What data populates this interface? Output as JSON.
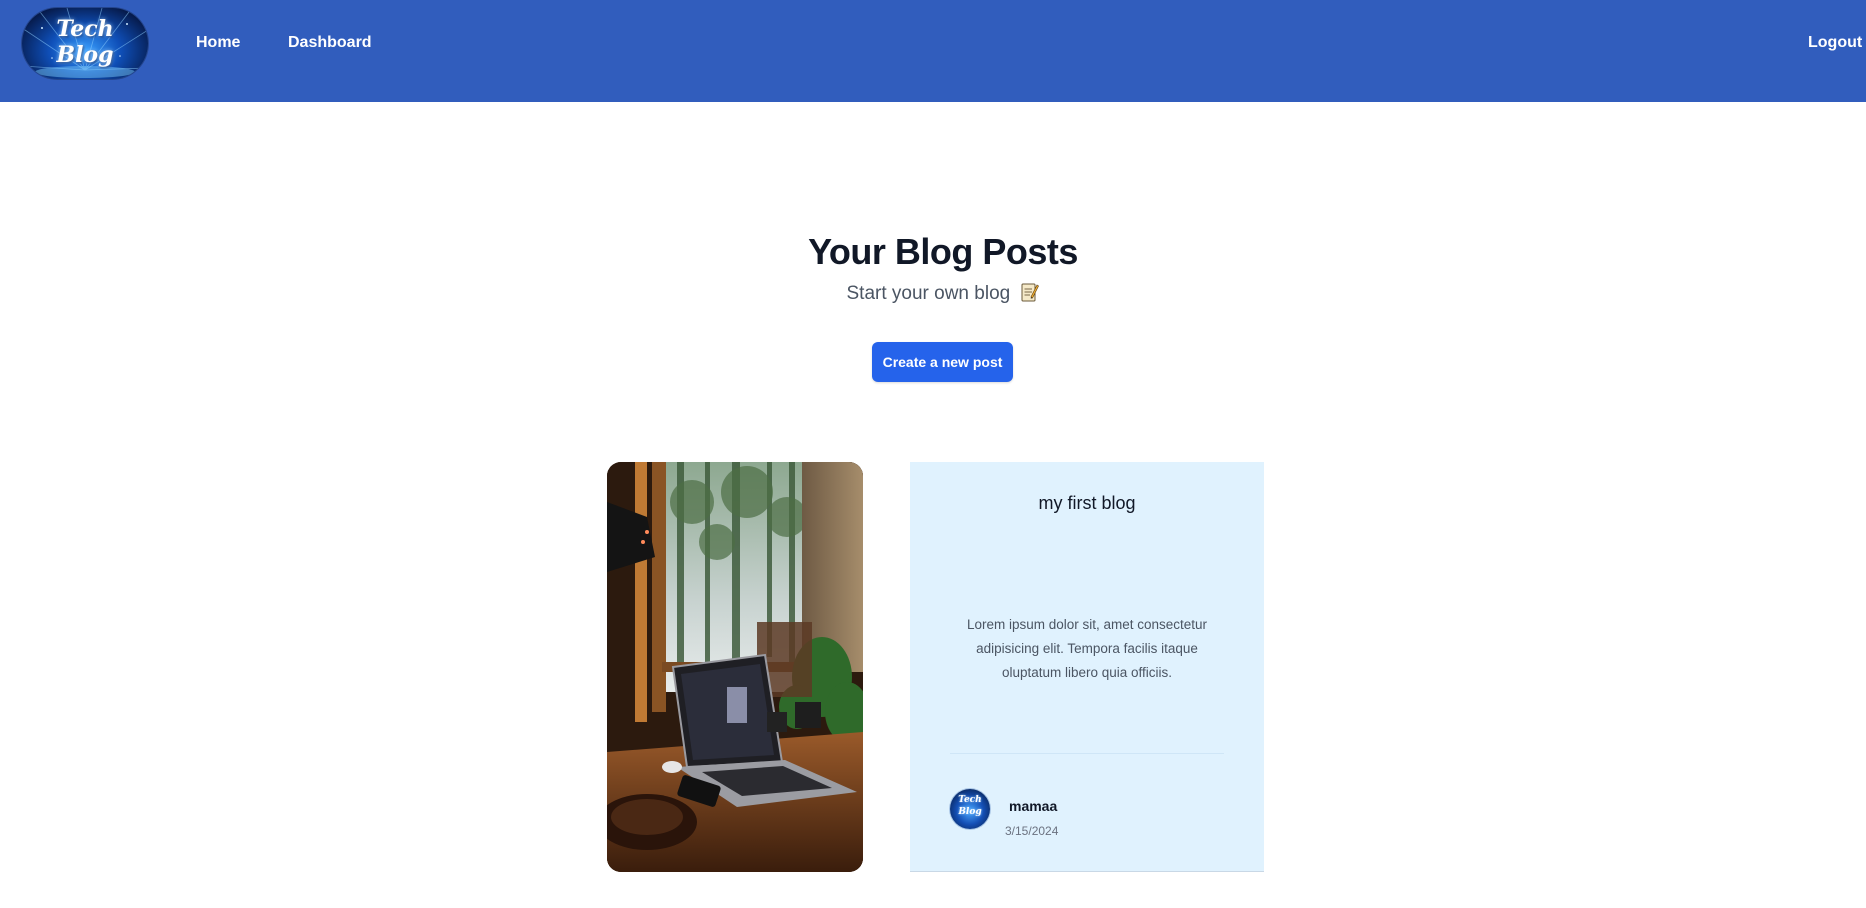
{
  "navbar": {
    "logo_text": "Tech\nBlog",
    "links": {
      "home": "Home",
      "dashboard": "Dashboard",
      "logout": "Logout"
    },
    "background_color": "#315dbd"
  },
  "hero": {
    "title": "Your Blog Posts",
    "subtitle": "Start your own blog",
    "subtitle_icon": "memo-icon",
    "cta_label": "Create a new post",
    "cta_color": "#2563eb"
  },
  "posts": [
    {
      "image_icon": "laptop-desk-photo",
      "title": "my first blog",
      "excerpt": "Lorem ipsum dolor sit, amet consectetur adipisicing elit. Tempora facilis itaque oluptatum libero quia officiis.",
      "author": {
        "name": "mamaa",
        "avatar_text": "Tech\nBlog"
      },
      "date": "3/15/2024",
      "panel_color": "#e0f2fe"
    }
  ]
}
